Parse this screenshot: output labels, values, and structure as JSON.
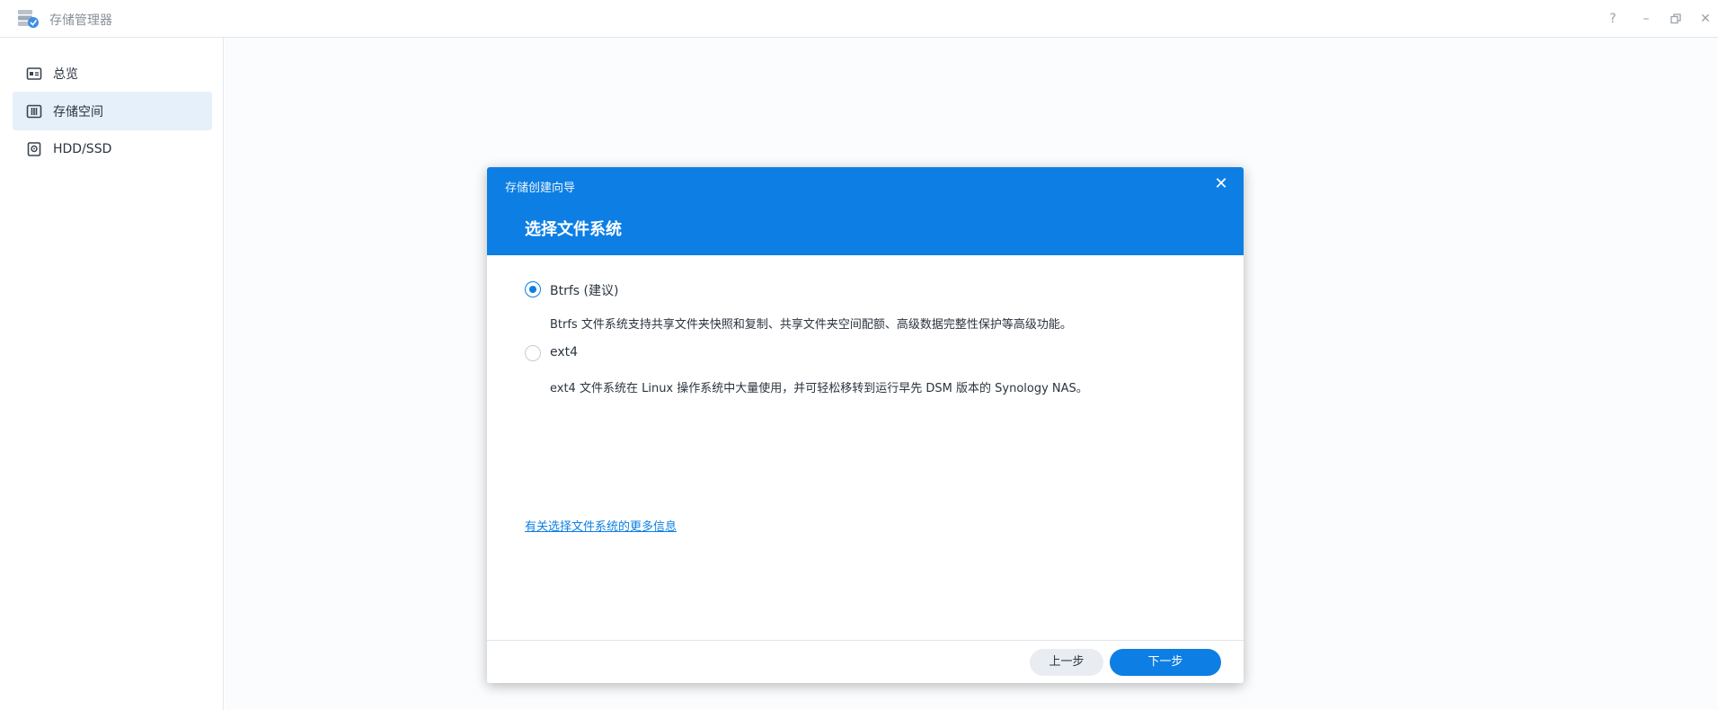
{
  "app": {
    "title": "存储管理器",
    "icon": "storage-manager-icon"
  },
  "window_controls": {
    "help": "?",
    "minimize": "–",
    "restore": "⧉",
    "close": "✕"
  },
  "sidebar": {
    "items": [
      {
        "label": "总览",
        "icon": "overview-icon",
        "active": false
      },
      {
        "label": "存储空间",
        "icon": "storage-pool-icon",
        "active": true
      },
      {
        "label": "HDD/SSD",
        "icon": "hdd-icon",
        "active": false
      }
    ]
  },
  "dialog": {
    "wizard_title": "存储创建向导",
    "close_glyph": "✕",
    "step_title": "选择文件系统",
    "options": [
      {
        "label": "Btrfs (建议)",
        "selected": true,
        "description": "Btrfs 文件系统支持共享文件夹快照和复制、共享文件夹空间配额、高级数据完整性保护等高级功能。"
      },
      {
        "label": "ext4",
        "selected": false,
        "description": "ext4 文件系统在 Linux 操作系统中大量使用，并可轻松移转到运行早先 DSM 版本的 Synology NAS。"
      }
    ],
    "more_info_link": "有关选择文件系统的更多信息",
    "footer": {
      "back_label": "上一步",
      "next_label": "下一步"
    }
  },
  "colors": {
    "accent": "#0d7fe4",
    "active_nav_bg": "#e5f0fb",
    "text": "#2b3440"
  }
}
